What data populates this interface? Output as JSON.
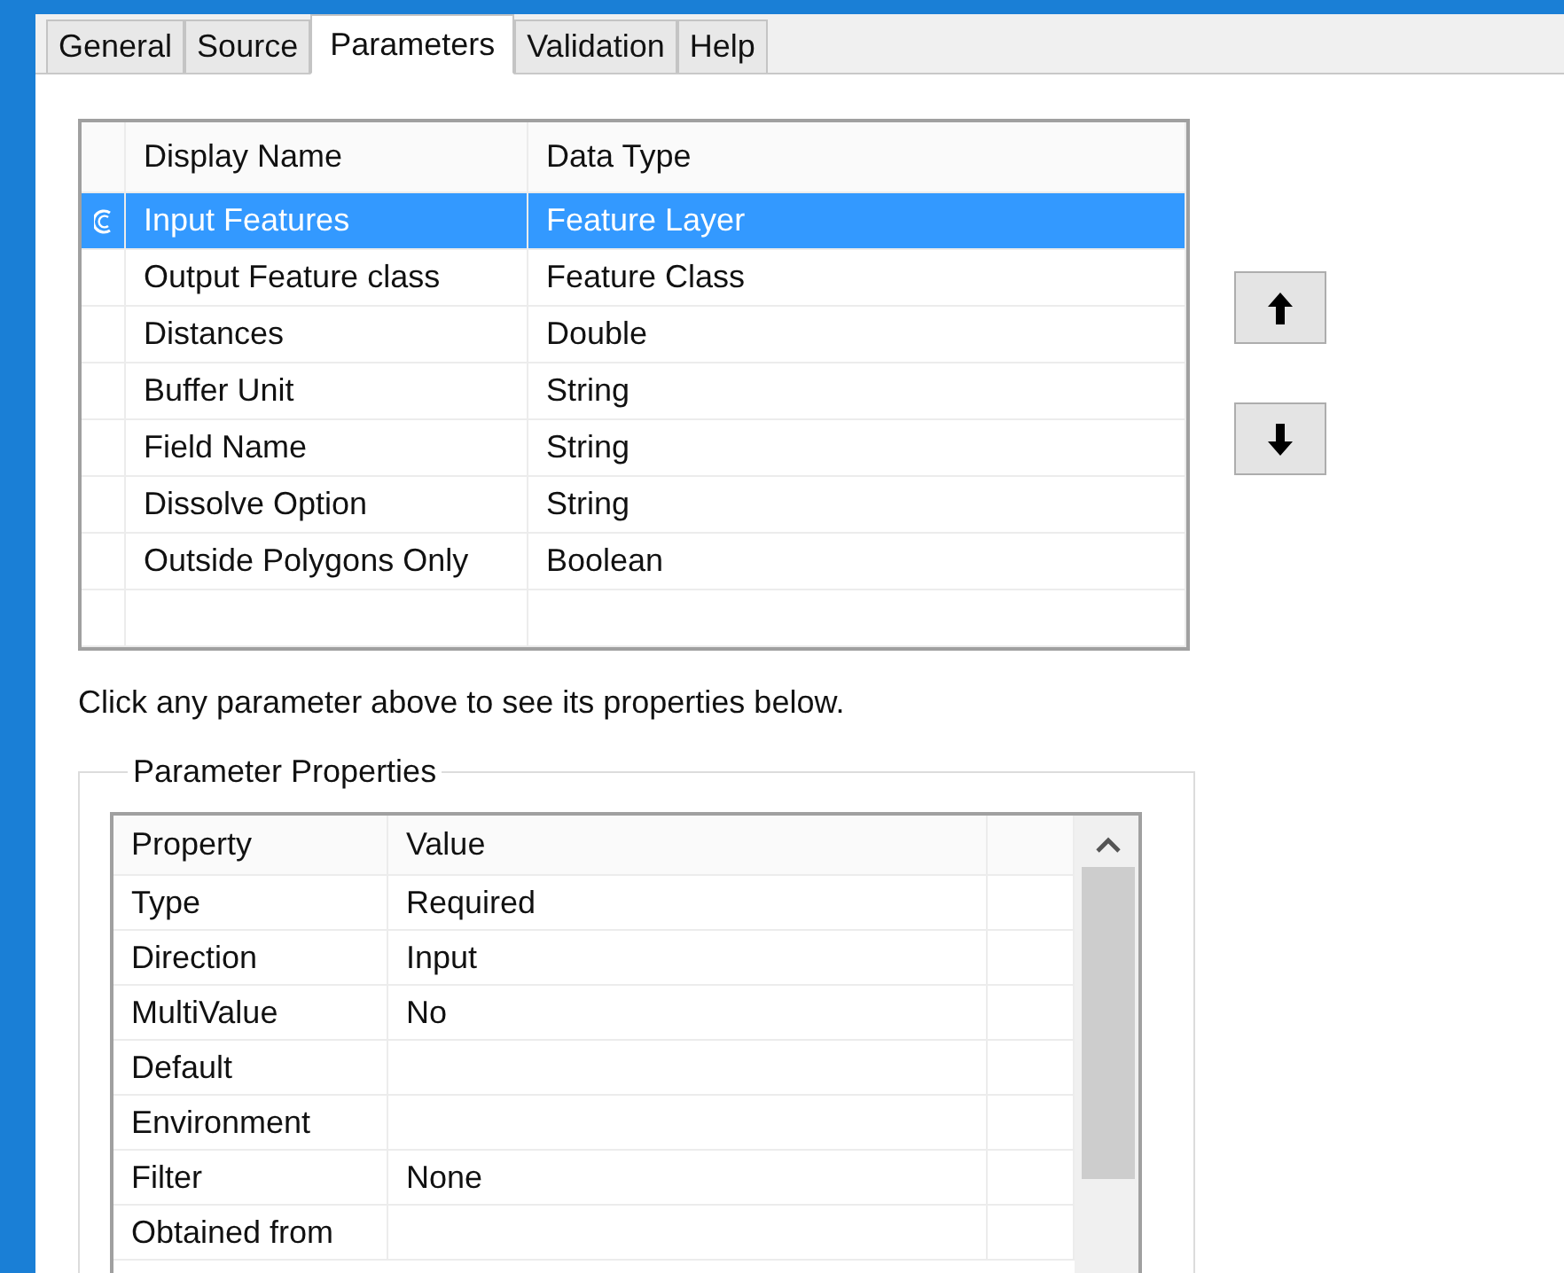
{
  "tabs": [
    {
      "label": "General",
      "selected": false
    },
    {
      "label": "Source",
      "selected": false
    },
    {
      "label": "Parameters",
      "selected": true
    },
    {
      "label": "Validation",
      "selected": false
    },
    {
      "label": "Help",
      "selected": false
    }
  ],
  "parameters": {
    "columns": [
      "Display Name",
      "Data Type"
    ],
    "rows": [
      {
        "name": "Input Features",
        "type": "Feature Layer",
        "selected": true
      },
      {
        "name": "Output Feature class",
        "type": "Feature Class",
        "selected": false
      },
      {
        "name": "Distances",
        "type": "Double",
        "selected": false
      },
      {
        "name": "Buffer Unit",
        "type": "String",
        "selected": false
      },
      {
        "name": "Field Name",
        "type": "String",
        "selected": false
      },
      {
        "name": "Dissolve Option",
        "type": "String",
        "selected": false
      },
      {
        "name": "Outside Polygons Only",
        "type": "Boolean",
        "selected": false
      }
    ]
  },
  "hint": "Click any parameter above to see its properties below.",
  "properties": {
    "title": "Parameter Properties",
    "columns": [
      "Property",
      "Value"
    ],
    "rows": [
      {
        "property": "Type",
        "value": "Required"
      },
      {
        "property": "Direction",
        "value": "Input"
      },
      {
        "property": "MultiValue",
        "value": "No"
      },
      {
        "property": "Default"
      },
      {
        "property": "Environment"
      },
      {
        "property": "Filter",
        "value": "None"
      },
      {
        "property": "Obtained from"
      }
    ]
  }
}
